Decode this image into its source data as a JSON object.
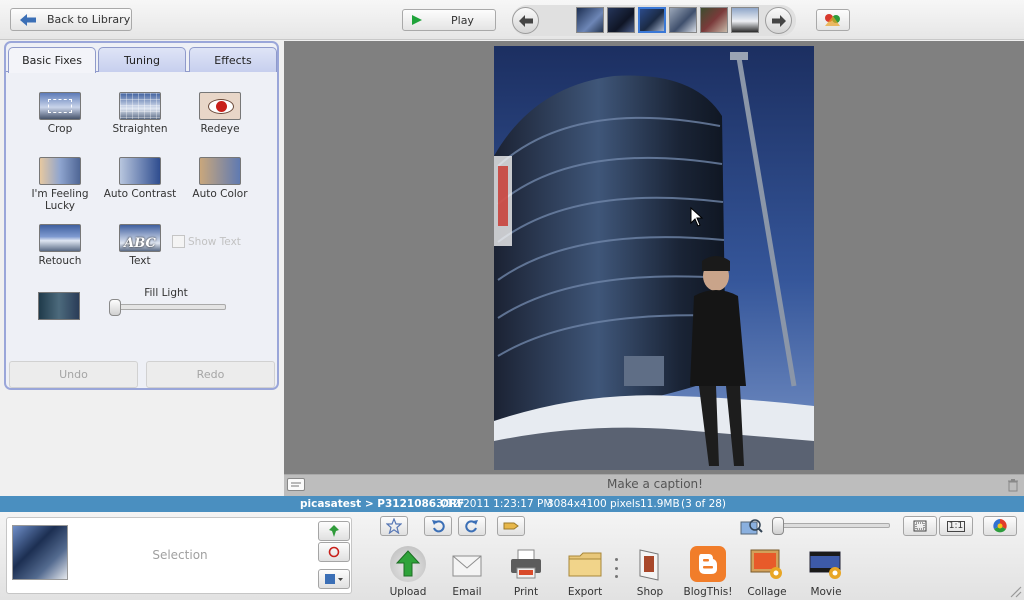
{
  "topbar": {
    "back_label": "Back to Library",
    "play_label": "Play"
  },
  "tabs": [
    {
      "label": "Basic Fixes"
    },
    {
      "label": "Tuning"
    },
    {
      "label": "Effects"
    }
  ],
  "tools": {
    "crop": "Crop",
    "straighten": "Straighten",
    "redeye": "Redeye",
    "lucky": "I'm Feeling Lucky",
    "auto_contrast": "Auto Contrast",
    "auto_color": "Auto Color",
    "retouch": "Retouch",
    "text": "Text",
    "text_glyph": "ABC",
    "show_text": "Show Text",
    "fill_light": "Fill Light",
    "fill_light_level": 0,
    "undo": "Undo",
    "redo": "Redo"
  },
  "caption_placeholder": "Make a caption!",
  "info": {
    "path": "picasatest > P3121086.ORF",
    "datetime": "3/12/2011 1:23:17 PM",
    "dimensions": "3084x4100 pixels",
    "size": "11.9MB",
    "position": "(3 of 28)"
  },
  "tray": {
    "selection_label": "Selection"
  },
  "zoom": {
    "one_to_one": "1:1",
    "level": 0
  },
  "actions": [
    {
      "label": "Upload"
    },
    {
      "label": "Email"
    },
    {
      "label": "Print"
    },
    {
      "label": "Export"
    },
    {
      "label": "Shop"
    },
    {
      "label": "BlogThis!"
    },
    {
      "label": "Collage"
    },
    {
      "label": "Movie"
    }
  ],
  "colors": {
    "accent_blue": "#4a8fc0",
    "tab_border": "#9aa6d9",
    "viewer_bg": "#808080"
  }
}
